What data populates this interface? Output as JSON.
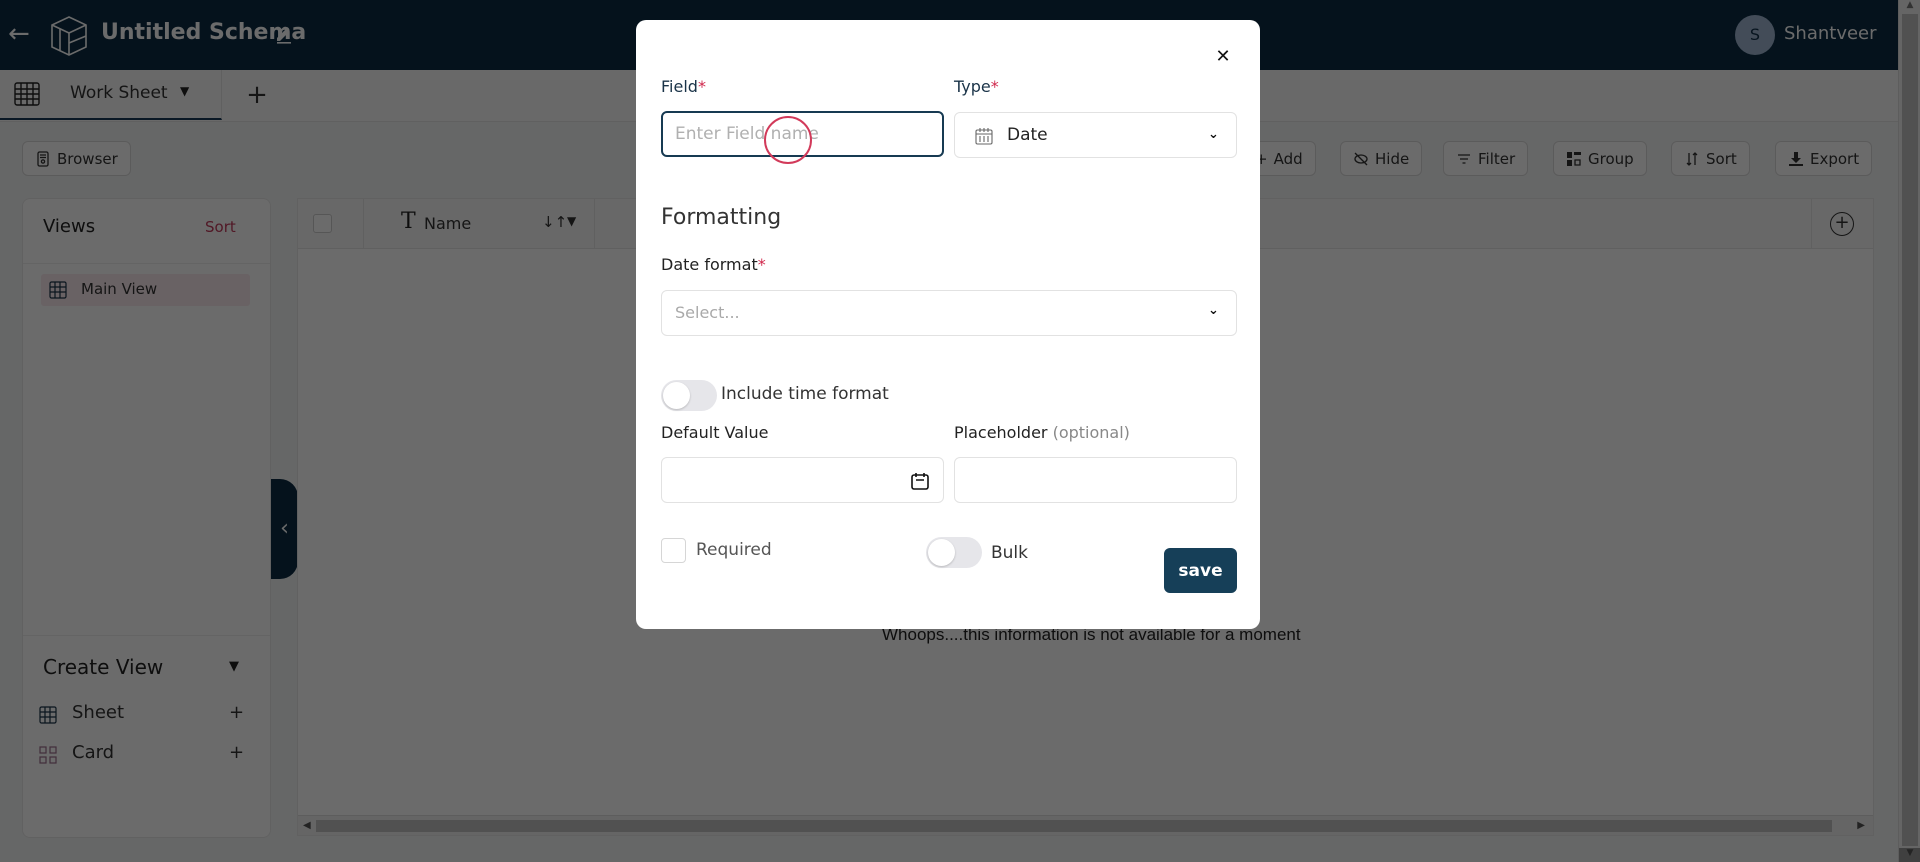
{
  "header": {
    "title": "Untitled Schema",
    "user_initial": "S",
    "user_name": "Shantveer"
  },
  "tabs": [
    {
      "label": "Work Sheet",
      "active": true
    }
  ],
  "toolbar": {
    "browser": "Browser",
    "add": "Add",
    "hide": "Hide",
    "filter": "Filter",
    "group": "Group",
    "sort": "Sort",
    "export": "Export"
  },
  "views_panel": {
    "title": "Views",
    "sort_label": "Sort",
    "views": [
      {
        "label": "Main View",
        "active": true
      }
    ],
    "create_view": {
      "title": "Create View",
      "items": [
        {
          "label": "Sheet",
          "icon": "grid-icon"
        },
        {
          "label": "Card",
          "icon": "card-grid-icon"
        }
      ]
    }
  },
  "grid": {
    "columns": [
      {
        "label": "Name",
        "type_icon": "T"
      }
    ],
    "empty_message": "Whoops....this information is not available for a moment"
  },
  "modal": {
    "field_label": "Field",
    "field_placeholder": "Enter Field name",
    "field_value": "",
    "type_label": "Type",
    "type_value": "Date",
    "formatting_heading": "Formatting",
    "date_format_label": "Date format",
    "date_format_placeholder": "Select...",
    "include_time_label": "Include time format",
    "include_time_on": false,
    "default_value_label": "Default Value",
    "default_value": "",
    "placeholder_label": "Placeholder",
    "placeholder_optional": "(optional)",
    "placeholder_value": "",
    "required_label": "Required",
    "required_checked": false,
    "bulk_label": "Bulk",
    "bulk_on": false,
    "save_label": "save",
    "required_marker": "*"
  },
  "colors": {
    "brand_navy": "#0c2d44",
    "accent_red": "#d0284c",
    "save_button": "#163f58"
  }
}
